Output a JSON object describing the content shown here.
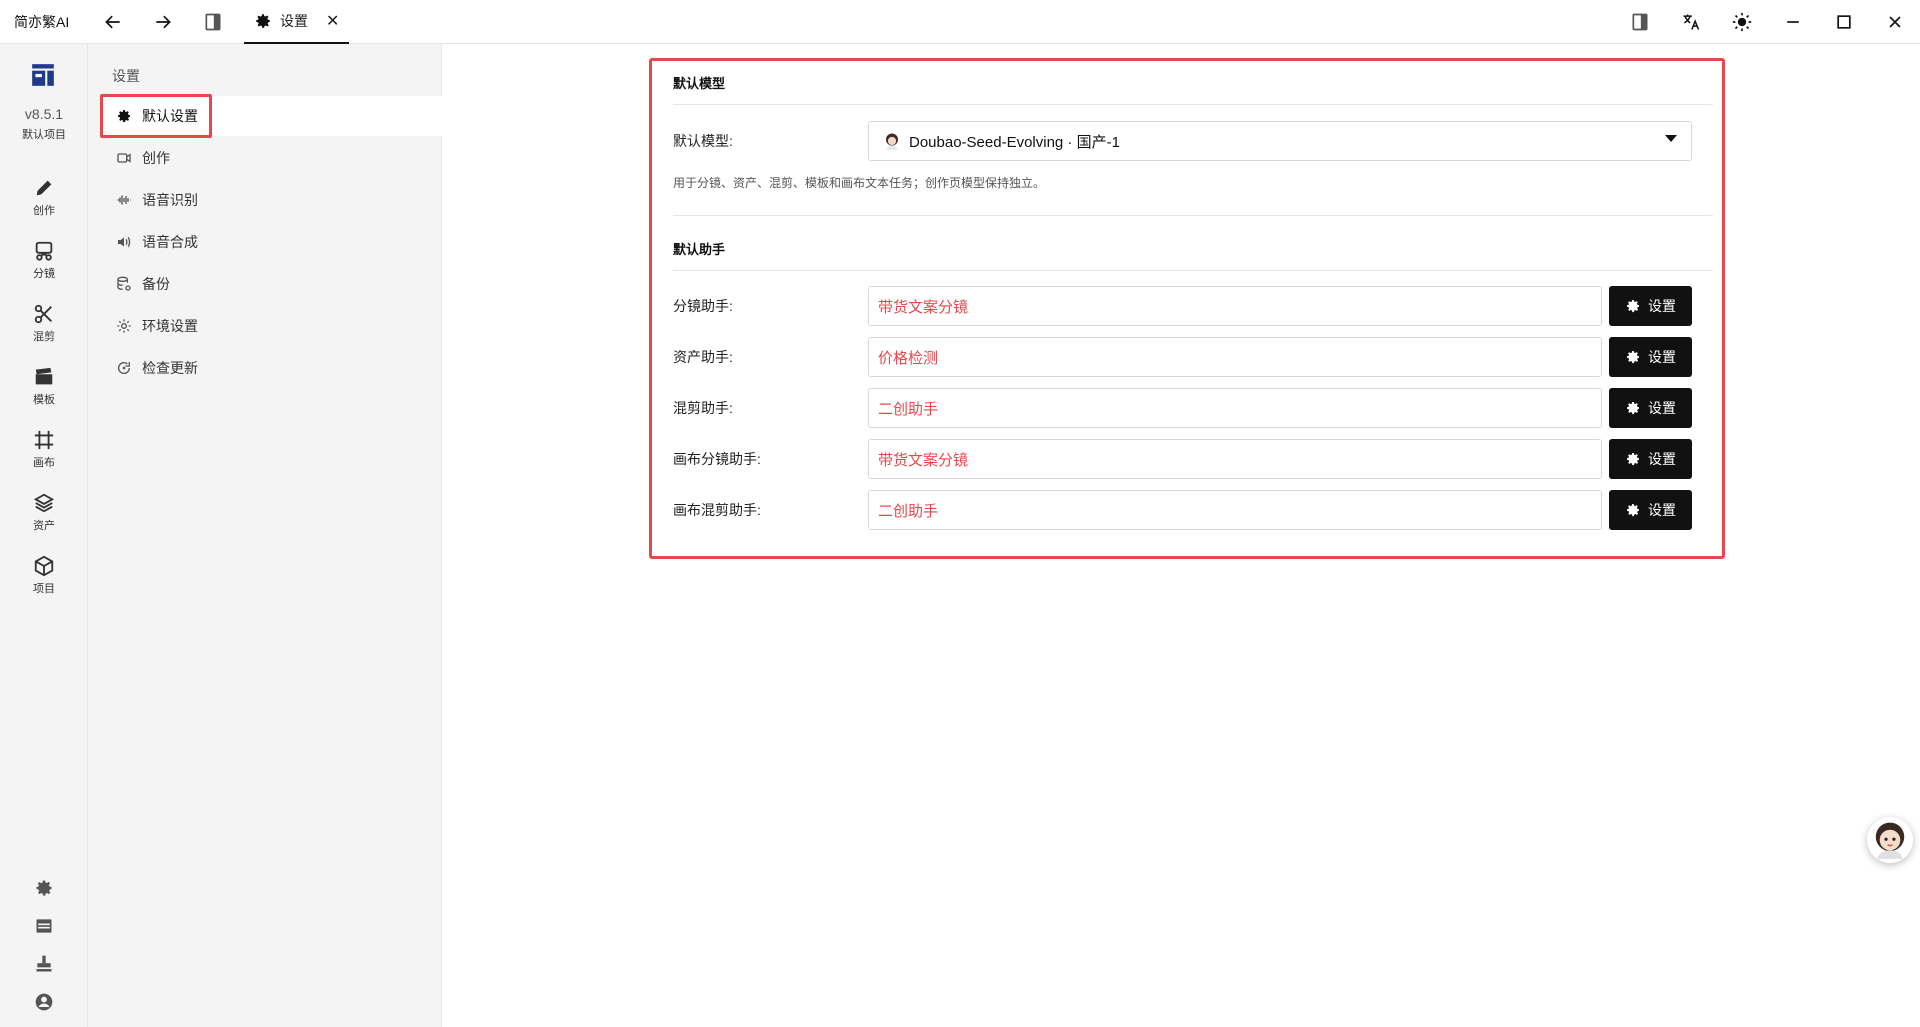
{
  "titlebar": {
    "app_name": "简亦繁AI",
    "tab_label": "设置",
    "tab_close": "✕"
  },
  "rail": {
    "version": "v8.5.1",
    "project": "默认项目",
    "items": [
      {
        "label": "创作",
        "icon": "pencil-icon"
      },
      {
        "label": "分镜",
        "icon": "storyboard-icon"
      },
      {
        "label": "混剪",
        "icon": "scissors-icon"
      },
      {
        "label": "模板",
        "icon": "clapper-icon"
      },
      {
        "label": "画布",
        "icon": "canvas-frame-icon"
      },
      {
        "label": "资产",
        "icon": "layers-icon"
      },
      {
        "label": "项目",
        "icon": "cube-icon"
      }
    ],
    "bottom_icons": [
      "settings-gear-icon",
      "panel-icon",
      "stamp-icon",
      "account-icon"
    ]
  },
  "settings_nav": {
    "title": "设置",
    "items": [
      {
        "label": "默认设置",
        "icon": "gear-icon",
        "active": true
      },
      {
        "label": "创作",
        "icon": "video-camera-icon",
        "active": false
      },
      {
        "label": "语音识别",
        "icon": "waveform-icon",
        "active": false
      },
      {
        "label": "语音合成",
        "icon": "speaker-icon",
        "active": false
      },
      {
        "label": "备份",
        "icon": "database-icon",
        "active": false
      },
      {
        "label": "环境设置",
        "icon": "cog-icon",
        "active": false
      },
      {
        "label": "检查更新",
        "icon": "refresh-icon",
        "active": false
      }
    ]
  },
  "main": {
    "default_model_section": "默认模型",
    "model_label": "默认模型:",
    "model_value": "Doubao-Seed-Evolving · 国产-1",
    "hint": "用于分镜、资产、混剪、模板和画布文本任务；创作页模型保持独立。",
    "assistant_section": "默认助手",
    "assistants": [
      {
        "label": "分镜助手:",
        "value": "带货文案分镜",
        "button": "设置"
      },
      {
        "label": "资产助手:",
        "value": "价格检测",
        "button": "设置"
      },
      {
        "label": "混剪助手:",
        "value": "二创助手",
        "button": "设置"
      },
      {
        "label": "画布分镜助手:",
        "value": "带货文案分镜",
        "button": "设置"
      },
      {
        "label": "画布混剪助手:",
        "value": "二创助手",
        "button": "设置"
      }
    ]
  },
  "colors": {
    "accent_red": "#e8484d",
    "button_dark": "#111111",
    "sidebar_bg": "#f4f4f4"
  }
}
